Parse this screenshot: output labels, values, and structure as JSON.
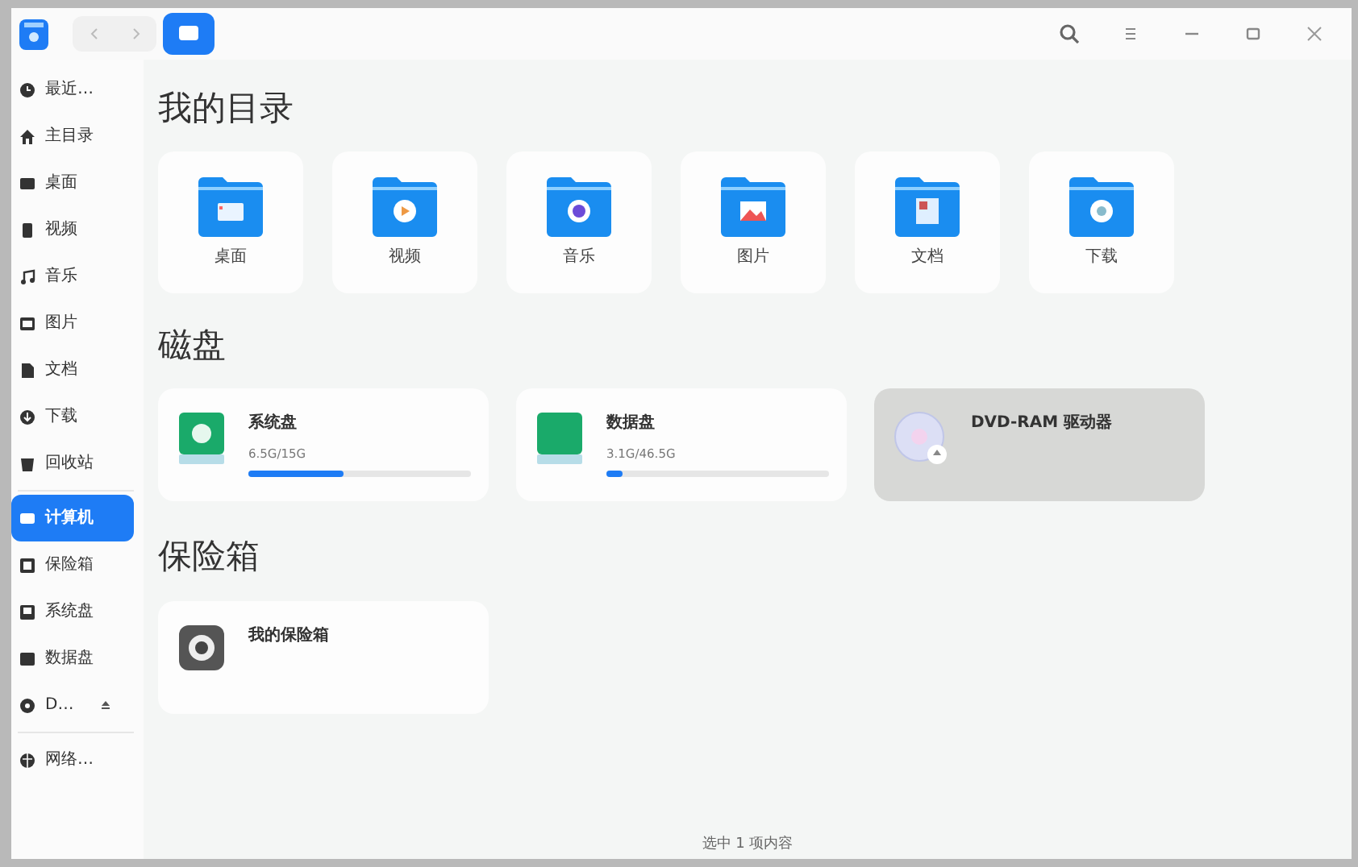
{
  "window": {
    "buttons": [
      {
        "kind": "search"
      },
      {
        "kind": "menu"
      },
      {
        "kind": "minimize"
      },
      {
        "kind": "maximize"
      },
      {
        "kind": "close"
      }
    ]
  },
  "sidebar": {
    "groups": [
      {
        "items": [
          {
            "label": "最近…",
            "kind": "clock",
            "selected": false,
            "ejectable": false
          },
          {
            "label": "主目录",
            "kind": "home",
            "selected": false,
            "ejectable": false
          },
          {
            "label": "桌面",
            "kind": "desktop",
            "selected": false,
            "ejectable": false
          },
          {
            "label": "视频",
            "kind": "video",
            "selected": false,
            "ejectable": false
          },
          {
            "label": "音乐",
            "kind": "music",
            "selected": false,
            "ejectable": false
          },
          {
            "label": "图片",
            "kind": "picture",
            "selected": false,
            "ejectable": false
          },
          {
            "label": "文档",
            "kind": "document",
            "selected": false,
            "ejectable": false
          },
          {
            "label": "下载",
            "kind": "download",
            "selected": false,
            "ejectable": false
          },
          {
            "label": "回收站",
            "kind": "trash",
            "selected": false,
            "ejectable": false
          }
        ]
      },
      {
        "items": [
          {
            "label": "计算机",
            "kind": "computer",
            "selected": true,
            "ejectable": false
          },
          {
            "label": "保险箱",
            "kind": "vault",
            "selected": false,
            "ejectable": false
          },
          {
            "label": "系统盘",
            "kind": "disk",
            "selected": false,
            "ejectable": false
          },
          {
            "label": "数据盘",
            "kind": "drive",
            "selected": false,
            "ejectable": false
          },
          {
            "label": "D…",
            "kind": "disc",
            "selected": false,
            "ejectable": true
          }
        ]
      },
      {
        "items": [
          {
            "label": "网络…",
            "kind": "network",
            "selected": false,
            "ejectable": false
          }
        ]
      }
    ]
  },
  "sections": [
    {
      "title": "我的目录",
      "kind": "folders",
      "items": [
        {
          "label": "桌面",
          "kind": "desktop"
        },
        {
          "label": "视频",
          "kind": "video"
        },
        {
          "label": "音乐",
          "kind": "music"
        },
        {
          "label": "图片",
          "kind": "picture"
        },
        {
          "label": "文档",
          "kind": "document"
        },
        {
          "label": "下载",
          "kind": "download"
        }
      ]
    },
    {
      "title": "磁盘",
      "kind": "disks",
      "items": [
        {
          "name": "系统盘",
          "kind": "system",
          "usage": "6.5G/15G",
          "level": 0.43,
          "selected": false
        },
        {
          "name": "数据盘",
          "kind": "data",
          "usage": "3.1G/46.5G",
          "level": 0.07,
          "selected": false
        },
        {
          "name": "DVD-RAM 驱动器",
          "kind": "optical",
          "selected": true
        }
      ]
    },
    {
      "title": "保险箱",
      "kind": "disks",
      "items": [
        {
          "name": "我的保险箱",
          "kind": "vault",
          "selected": false
        }
      ]
    }
  ],
  "status_bar": "选中 1 项内容"
}
